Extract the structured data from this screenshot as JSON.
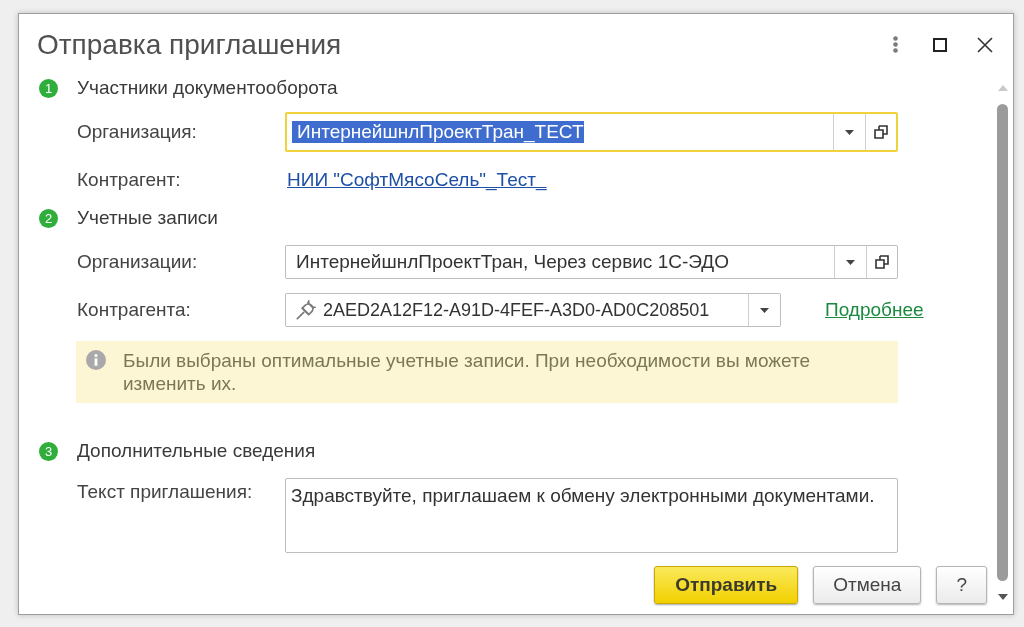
{
  "window": {
    "title": "Отправка приглашения"
  },
  "sections": [
    {
      "number": "1",
      "title": "Участники документооборота",
      "rows": [
        {
          "kind": "select",
          "label": "Организация:",
          "value": "ИнтернейшнлПроектТран_ТЕСТ",
          "focused": true
        },
        {
          "kind": "link",
          "label": "Контрагент:",
          "value": "НИИ \"СофтМясоСель\"_Тест_",
          "focused": false
        }
      ]
    },
    {
      "number": "2",
      "title": "Учетные записи",
      "rows": [
        {
          "kind": "select",
          "label": "Организации:",
          "value": "ИнтернейшнлПроектТран, Через сервис 1С-ЭДО",
          "focused": false
        },
        {
          "kind": "account",
          "label": "Контрагента:",
          "value": "2AED2A12F12-A91D-4FEF-A3D0-AD0C208501",
          "link": "Подробнее",
          "focused": false
        }
      ],
      "note": "Были выбраны оптимальные учетные записи. При необходимости вы можете изменить их."
    },
    {
      "number": "3",
      "title": "Дополнительные сведения",
      "rows": [
        {
          "kind": "textarea",
          "label": "Текст приглашения:",
          "value": "Здравствуйте, приглашаем к обмену электронными документами.",
          "focused": false
        }
      ]
    }
  ],
  "buttons": [
    {
      "kind": "primary",
      "label": "Отправить"
    },
    {
      "kind": "default",
      "label": "Отмена"
    },
    {
      "kind": "default",
      "label": "?"
    }
  ]
}
